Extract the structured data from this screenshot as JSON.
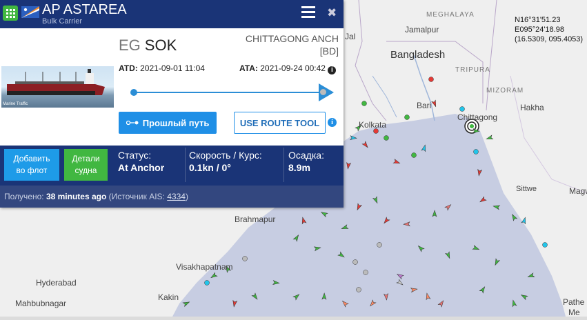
{
  "vessel": {
    "name": "AP ASTAREA",
    "type": "Bulk Carrier",
    "flag_icon": "marshall-islands-flag-icon"
  },
  "voyage": {
    "from_country": "EG",
    "from_port": "SOK",
    "to_port": "CHITTAGONG ANCH",
    "to_country": "[BD]",
    "atd_label": "ATD:",
    "atd_value": "2021-09-01 11:04",
    "ata_label": "ATA:",
    "ata_value": "2021-09-24 00:42",
    "progress": 1.0
  },
  "photo_caption": "Marine Traffic",
  "buttons": {
    "past_track": "Прошлый путь",
    "route_tool": "USE ROUTE TOOL",
    "add_fleet_1": "Добавить",
    "add_fleet_2": "во флот",
    "details_1": "Детали",
    "details_2": "судна"
  },
  "stats": {
    "status_label": "Статус:",
    "status_value": "At Anchor",
    "speed_label": "Скорость / Курс:",
    "speed_value": "0.1kn / 0°",
    "draught_label": "Осадка:",
    "draught_value": "8.9m"
  },
  "footer": {
    "received_label": "Получено:",
    "received_value": "38 minutes ago",
    "source_label": "(Источник AIS:",
    "source_value": "4334",
    "source_close": ")"
  },
  "map": {
    "coords": [
      "N16°31'51.23",
      "E095°24'18.98",
      "(16.5309, 095.4053)"
    ],
    "labels": {
      "bangladesh": "Bangladesh",
      "meghalaya": "MEGHALAYA",
      "jamalpur": "Jamalpur",
      "mizoram": "MIZORAM",
      "tripura": "TRIPURA",
      "hakha": "Hakha",
      "chittagong": "Chittagong",
      "barisal": "Bari",
      "kolkata": "Kolkata",
      "sittwe": "Sittwe",
      "magway": "Magw",
      "brahmapur": "Brahmapur",
      "visakhapatnam": "Visakhapatnam",
      "hyderabad": "Hyderabad",
      "mahbubnagar": "Mahbubnagar",
      "kakinada": "Kakin",
      "pathein": "Pathe",
      "me": "Me",
      "jalpaiguri": "Jal"
    },
    "colors": {
      "land": "#efefef",
      "sea": "#c7cde2",
      "header": "#1a3477",
      "accent": "#1f8fe6",
      "green": "#41b741"
    }
  }
}
